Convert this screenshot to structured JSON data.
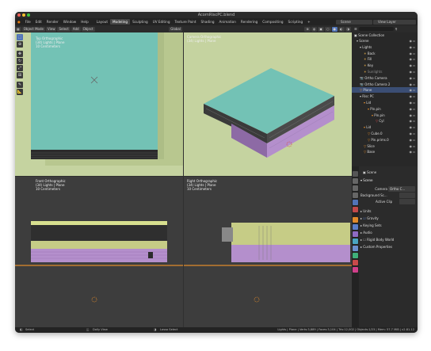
{
  "window": {
    "title": "AcornRiscPC.blend"
  },
  "menubar": {
    "menus": [
      "File",
      "Edit",
      "Render",
      "Window",
      "Help"
    ],
    "workspaces": [
      "Layout",
      "Modeling",
      "Sculpting",
      "UV Editing",
      "Texture Paint",
      "Shading",
      "Animation",
      "Rendering",
      "Compositing",
      "Scripting"
    ],
    "active_workspace": "Modeling",
    "add_tab": "+",
    "scene": "Scene",
    "view_layer": "View Layer"
  },
  "viewport_header": {
    "mode": "Object Mode",
    "view": "View",
    "select": "Select",
    "add": "Add",
    "object": "Object",
    "transform": "Global"
  },
  "viewports": {
    "top_left": {
      "title": "Top Orthographic",
      "collection": "(34) Lights | Plane",
      "units": "10 Centimeters"
    },
    "top_right": {
      "title": "Camera Orthographic",
      "collection": "(34) Lights | Plane"
    },
    "bottom_left": {
      "title": "Front Orthographic",
      "collection": "(34) Lights | Plane",
      "units": "10 Centimeters"
    },
    "bottom_right": {
      "title": "Right Orthographic",
      "collection": "(34) Lights | Plane",
      "units": "10 Centimeters"
    }
  },
  "outliner": {
    "header": "Scene Collection",
    "items": [
      {
        "label": "Scene"
      },
      {
        "label": "Lights"
      },
      {
        "label": "Back"
      },
      {
        "label": "Fill"
      },
      {
        "label": "Key"
      },
      {
        "label": "Sunlights"
      },
      {
        "label": "Ortho Camera"
      },
      {
        "label": "Ortho Camera 2"
      },
      {
        "label": "Plane"
      },
      {
        "label": "Risc PC"
      },
      {
        "label": "Lid"
      },
      {
        "label": "Pin.pin"
      },
      {
        "label": "Pin.pin"
      },
      {
        "label": "Cyl"
      },
      {
        "label": "Lid"
      },
      {
        "label": "Cube.0"
      },
      {
        "label": "Pin.prims.0"
      },
      {
        "label": "Slice"
      },
      {
        "label": "Base"
      }
    ]
  },
  "properties": {
    "header": "Scene",
    "section": "Scene",
    "camera_label": "Camera",
    "camera_value": "Ortho C...",
    "bg_label": "Background Sc...",
    "clip_label": "Active Clip",
    "panels": [
      "Units",
      "Gravity",
      "Keying Sets",
      "Audio",
      "Rigid Body World",
      "Custom Properties"
    ]
  },
  "statusbar": {
    "select": "Select",
    "dolly": "Dolly View",
    "lasso": "Lasso Select",
    "stats": "Lights | Plane | Verts:3,889 | Faces:3,104 | Tris:12,002 | Objects:1/23 | Mem: 57.7 MiB | v2.81.12"
  },
  "colors": {
    "accent": "#5174b8",
    "viewport_bg": "#c5d3a0",
    "teal": "#6fbcb0",
    "purple": "#b48fcc",
    "orange": "#e08a2b"
  }
}
